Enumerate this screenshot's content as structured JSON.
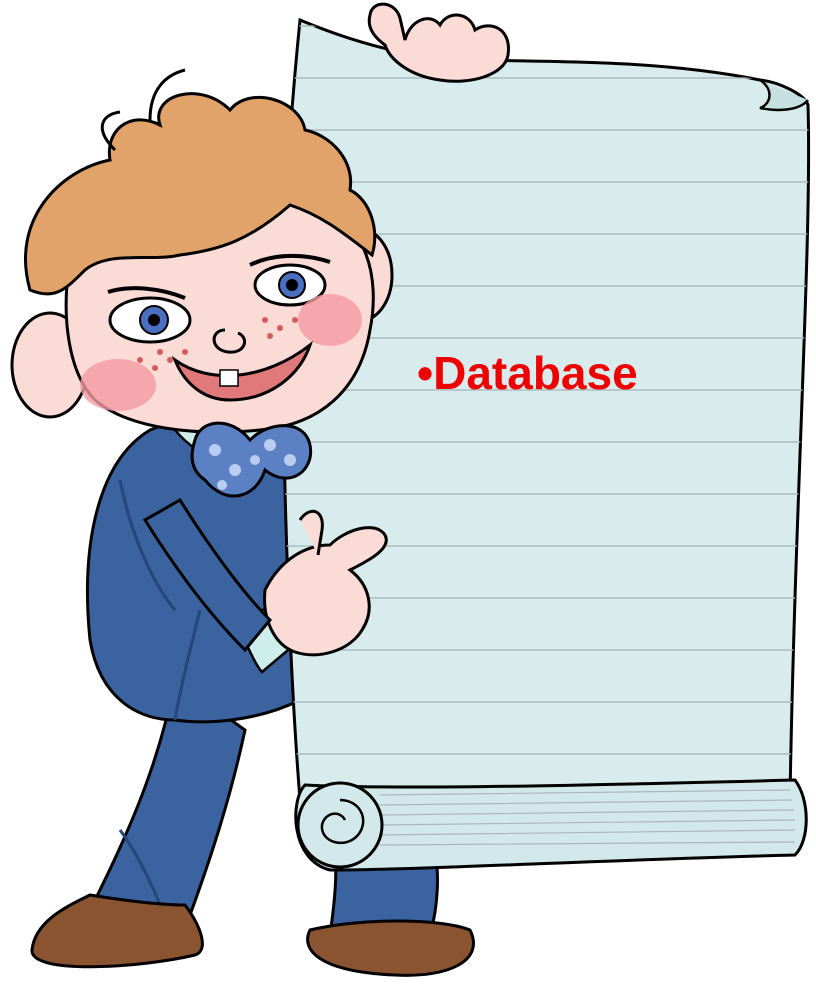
{
  "scroll": {
    "bullet": "•",
    "text": "Database"
  },
  "colors": {
    "text": "#ee0000",
    "paper": "#d8ecee",
    "paper_line": "#aab7ba",
    "suit": "#3a639f",
    "suit_dark": "#24477c",
    "skin": "#fbdbd6",
    "hair": "#e2a36a",
    "shoe": "#8a5430",
    "bowtie": "#5b81c4",
    "cheek": "#f49aa3",
    "outline": "#000000"
  },
  "icons": [
    "boy-cartoon-icon",
    "scroll-paper-icon"
  ]
}
